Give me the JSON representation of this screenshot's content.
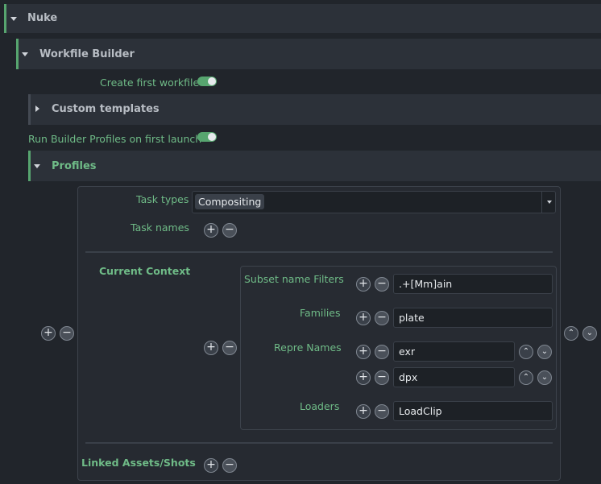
{
  "nuke": {
    "title": "Nuke"
  },
  "workfile_builder": {
    "title": "Workfile Builder",
    "create_first_workfile_label": "Create first workfile",
    "create_first_workfile": true,
    "custom_templates_title": "Custom templates",
    "run_builder_profiles_label": "Run Builder Profiles on first launch",
    "run_builder_profiles": true,
    "profiles_title": "Profiles"
  },
  "profile": {
    "task_types_label": "Task types",
    "task_types_tag": "Compositing",
    "task_names_label": "Task names",
    "current_context_label": "Current Context",
    "subset_filters_label": "Subset name Filters",
    "subset_filter_value": ".+[Mm]ain",
    "families_label": "Families",
    "families_value": "plate",
    "repre_names_label": "Repre Names",
    "repre_names": [
      "exr",
      "dpx"
    ],
    "loaders_label": "Loaders",
    "loaders_value": "LoadClip",
    "linked_assets_label": "Linked Assets/Shots"
  },
  "icons": {
    "plus": "+",
    "minus": "−",
    "up": "⌃",
    "down": "⌄"
  },
  "colors": {
    "accent": "#57a56f",
    "label": "#6fbb87",
    "background": "#21252b"
  }
}
